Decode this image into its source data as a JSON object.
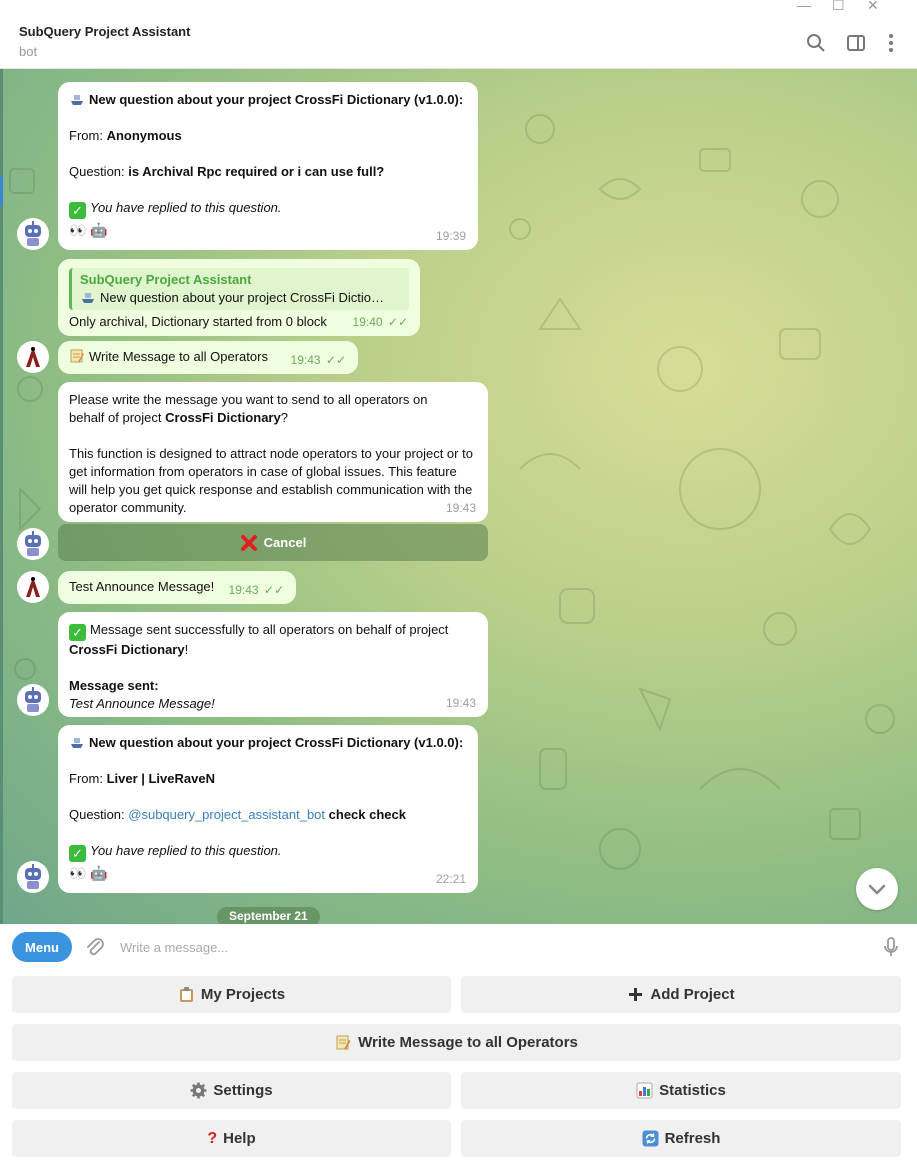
{
  "header": {
    "title": "SubQuery Project Assistant",
    "subtitle": "bot"
  },
  "messages": [
    {
      "title": "New question about your project CrossFi Dictionary (v1.0.0):",
      "from_label": "From: ",
      "from": "Anonymous",
      "question_label": "Question: ",
      "question": "is Archival Rpc required or i can use full?",
      "replied": "You have replied to this question.",
      "time": "19:39"
    },
    {
      "quote_name": "SubQuery Project Assistant",
      "quote_text": "New question about your project CrossFi Dictio…",
      "text": "Only archival, Dictionary started from 0 block",
      "time": "19:40"
    },
    {
      "text": "Write Message to all Operators",
      "time": "19:43"
    },
    {
      "line1": "Please write the message you want to send to all operators on",
      "line2_pre": "behalf of project ",
      "line2_bold": "CrossFi Dictionary",
      "line2_post": "?",
      "para2": "This function is designed to attract node operators to your project or to get information from operators in case of global issues. This feature will help you get quick response and establish communication with the operator community.",
      "time": "19:43",
      "button": "Cancel"
    },
    {
      "text": "Test Announce Message!",
      "time": "19:43"
    },
    {
      "line1": "Message sent successfully to all operators on behalf of project",
      "line2_bold": "CrossFi Dictionary",
      "line2_post": "!",
      "sent_label": "Message sent:",
      "sent_text": "Test Announce Message!",
      "time": "19:43"
    },
    {
      "title": "New question about your project CrossFi Dictionary (v1.0.0):",
      "from_label": "From: ",
      "from": "Liver | LiveRaveN",
      "question_label": "Question: ",
      "mention": "@subquery_project_assistant_bot",
      "question": " check check",
      "replied": "You have replied to this question.",
      "time": "22:21"
    }
  ],
  "date_separator": "September 21",
  "composer": {
    "menu": "Menu",
    "placeholder": "Write a message..."
  },
  "keyboard": {
    "my_projects": "My Projects",
    "add_project": "Add Project",
    "write_message": "Write Message to all Operators",
    "settings": "Settings",
    "statistics": "Statistics",
    "help": "Help",
    "refresh": "Refresh"
  },
  "colors": {
    "accent": "#3a93de",
    "outgoing_bubble": "#eefedf",
    "check_green": "#6dab5e"
  }
}
